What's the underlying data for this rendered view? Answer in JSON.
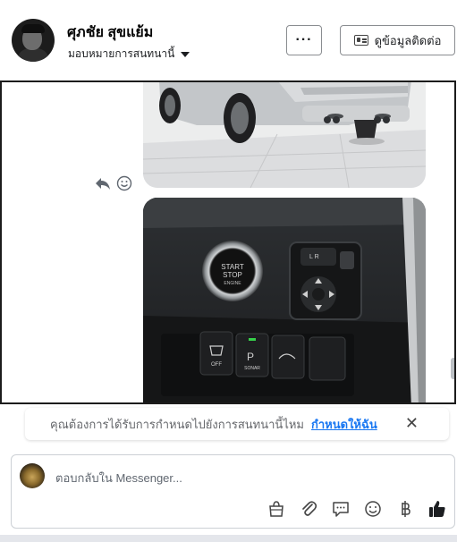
{
  "header": {
    "name": "ศุภชัย สุขแย้ม",
    "subtitle": "มอบหมายการสนทนานี้",
    "more_label": "···",
    "contact_label": "ดูข้อมูลติดต่อ"
  },
  "notice": {
    "text": "คุณต้องการได้รับการกำหนดไปยังการสนทนานี้ไหม",
    "link": "กำหนดให้ฉัน",
    "close": "✕"
  },
  "composer": {
    "placeholder": "ตอบกลับใน Messenger..."
  },
  "image2_labels": {
    "start": "START",
    "stop": "STOP",
    "engine": "ENGINE",
    "off": "OFF",
    "p": "P",
    "sonar": "SONAR",
    "lr": "L  R"
  },
  "colors": {
    "accent": "#1877f2",
    "thumb": "#1877f2"
  }
}
